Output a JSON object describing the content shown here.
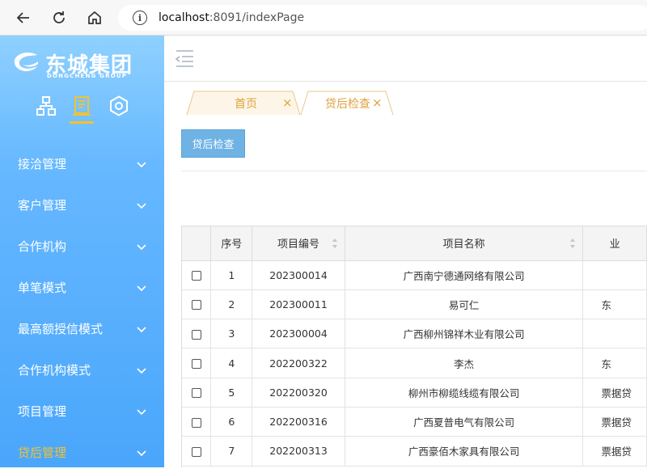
{
  "browser": {
    "url_host": "localhost",
    "url_rest": ":8091/indexPage",
    "info_glyph": "i"
  },
  "sidebar": {
    "logo_text": "东城集团",
    "logo_sub": "DONGCHENG GROUP",
    "active_color": "#f2c230",
    "items": [
      {
        "label": "接洽管理"
      },
      {
        "label": "客户管理"
      },
      {
        "label": "合作机构"
      },
      {
        "label": "单笔模式"
      },
      {
        "label": "最高额授信模式"
      },
      {
        "label": "合作机构模式"
      },
      {
        "label": "项目管理"
      },
      {
        "label": "贷后管理",
        "active": true
      }
    ]
  },
  "tabs": [
    {
      "label": "首页",
      "close": "×"
    },
    {
      "label": "贷后检查",
      "close": "×"
    }
  ],
  "action_button": "贷后检查",
  "table": {
    "columns": [
      "序号",
      "项目编号",
      "项目名称",
      "业"
    ],
    "rows": [
      {
        "no": "1",
        "code": "202300014",
        "name": "广西南宁德通网络有限公司",
        "extra": ""
      },
      {
        "no": "2",
        "code": "202300011",
        "name": "易可仁",
        "extra": "东"
      },
      {
        "no": "3",
        "code": "202300004",
        "name": "广西柳州锦祥木业有限公司",
        "extra": ""
      },
      {
        "no": "4",
        "code": "202200322",
        "name": "李杰",
        "extra": "东"
      },
      {
        "no": "5",
        "code": "202200320",
        "name": "柳州市柳缆线缆有限公司",
        "extra": "票据贷"
      },
      {
        "no": "6",
        "code": "202200316",
        "name": "广西夏普电气有限公司",
        "extra": "票据贷"
      },
      {
        "no": "7",
        "code": "202200313",
        "name": "广西豪佰木家具有限公司",
        "extra": "票据贷"
      }
    ]
  }
}
